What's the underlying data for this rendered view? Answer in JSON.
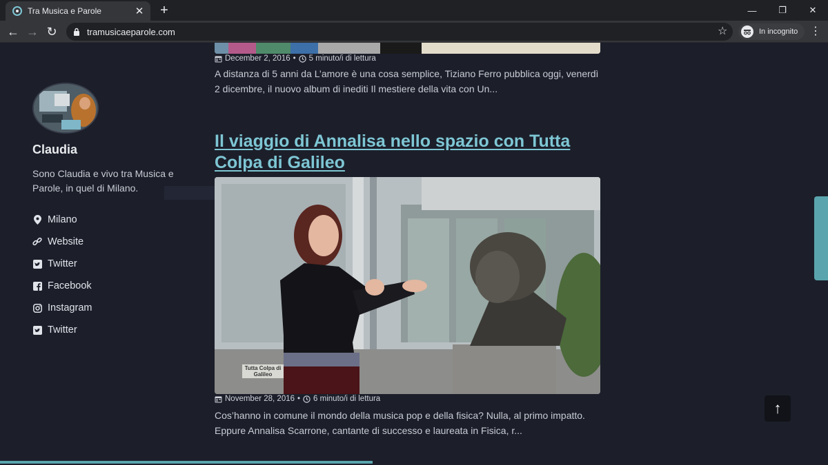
{
  "browser": {
    "tab_title": "Tra Musica e Parole",
    "url": "tramusicaeparole.com",
    "incognito_label": "In incognito"
  },
  "sidebar": {
    "author_name": "Claudia",
    "bio": "Sono Claudia e vivo tra Musica e Parole, in quel di Milano.",
    "links": [
      {
        "icon": "map-pin-icon",
        "label": "Milano"
      },
      {
        "icon": "link-icon",
        "label": "Website"
      },
      {
        "icon": "twitter-icon",
        "label": "Twitter"
      },
      {
        "icon": "facebook-icon",
        "label": "Facebook"
      },
      {
        "icon": "instagram-icon",
        "label": "Instagram"
      },
      {
        "icon": "twitter-icon",
        "label": "Twitter"
      }
    ]
  },
  "posts": [
    {
      "date": "December 2, 2016",
      "reading_time": "5 minuto/i di lettura",
      "excerpt": "A distanza di 5 anni da L’amore è una cosa semplice, Tiziano Ferro pubblica oggi, venerdì 2 dicembre, il nuovo album di inediti Il mestiere della vita con Un..."
    },
    {
      "title": "Il viaggio di Annalisa nello spazio con Tutta Colpa di Galileo",
      "date": "November 28, 2016",
      "reading_time": "6 minuto/i di lettura",
      "excerpt": "Cos’hanno in comune il mondo della musica pop e della fisica? Nulla, al primo impatto. Eppure Annalisa Scarrone, cantante di successo e laureata in Fisica, r...",
      "image_caption": "Tutta Colpa di Galileo"
    }
  ],
  "meta_separator": "•",
  "back_to_top_label": "↑",
  "colors": {
    "background": "#1c1f2a",
    "link": "#7ec6d4",
    "accent": "#5aa5ad"
  }
}
